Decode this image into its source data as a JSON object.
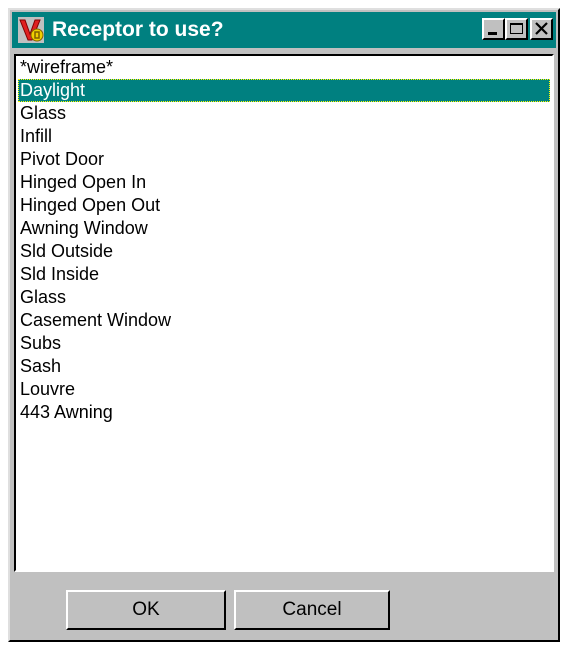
{
  "window": {
    "title": "Receptor to use?",
    "app_icon": "v6-app-icon",
    "controls": [
      "minimize-icon",
      "maximize-icon",
      "close-icon"
    ]
  },
  "list": {
    "selected_index": 1,
    "items": [
      "*wireframe*",
      "Daylight",
      "Glass",
      "Infill",
      "Pivot Door",
      "Hinged Open In",
      "Hinged Open Out",
      "Awning Window",
      "Sld Outside",
      "Sld Inside",
      "Glass",
      "Casement Window",
      "Subs",
      "Sash",
      "Louvre",
      "443 Awning"
    ]
  },
  "buttons": {
    "ok_label": "OK",
    "cancel_label": "Cancel"
  },
  "colors": {
    "titlebar": "#008080",
    "selection": "#008080",
    "face": "#c0c0c0"
  }
}
